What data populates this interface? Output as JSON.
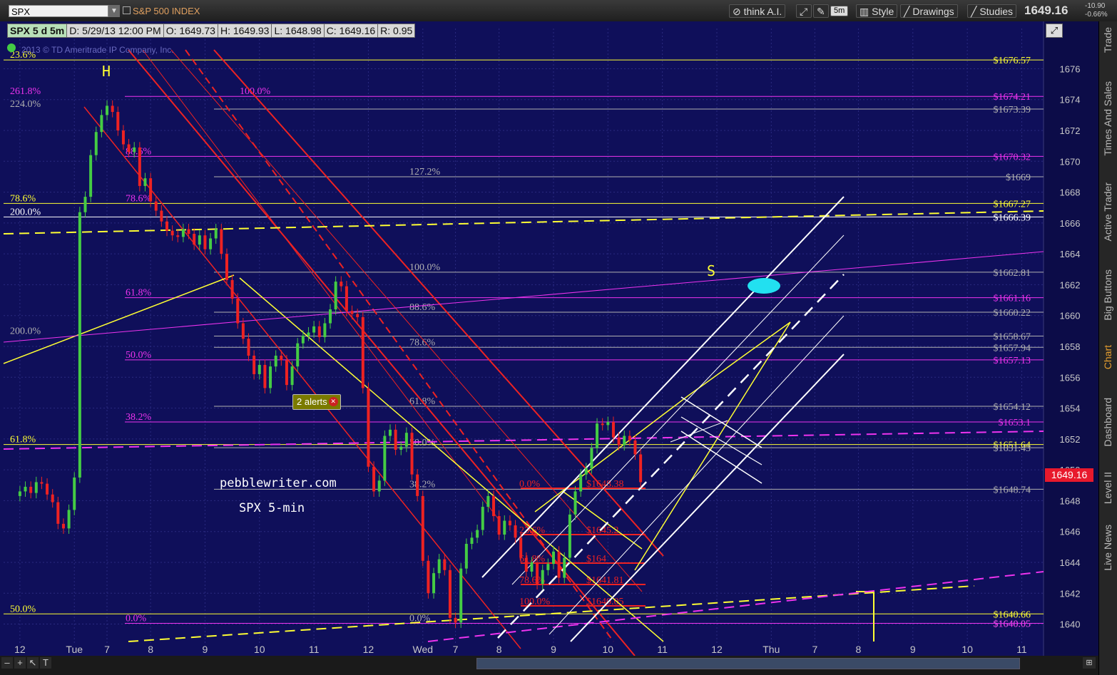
{
  "toolbar": {
    "symbol": "SPX",
    "index_name": "S&P 500 INDEX",
    "buttons": [
      "think A.I.",
      "5m",
      "Style",
      "Drawings",
      "Studies"
    ],
    "last_price": "1649.16",
    "change_abs": "-10.90",
    "change_pct": "-0.66%"
  },
  "quote_bar": {
    "symbol": "SPX 5 d 5m",
    "date": "D: 5/29/13 12:00 PM",
    "open": "O: 1649.73",
    "high": "H: 1649.93",
    "low": "L: 1648.98",
    "close": "C: 1649.16",
    "range": "R: 0.95"
  },
  "copyright": "2013 © TD Ameritrade IP Company, Inc.",
  "alerts_label": "2 alerts",
  "price_badge": "1649.16",
  "annotations": {
    "site": "pebblewriter.com",
    "subtitle": "SPX 5-min",
    "h_label": "H",
    "s_label": "S"
  },
  "sidebar_tabs": [
    "Trade",
    "Times And Sales",
    "Active Trader",
    "Big Buttons",
    "Chart",
    "Dashboard",
    "Level II",
    "Live News"
  ],
  "colors": {
    "background": "#10105a",
    "grid": "#2a2a80",
    "up_candle": "#44cc44",
    "down_candle": "#ee2222",
    "yellow": "#ffff33",
    "magenta": "#ee33ee",
    "gray_fib": "#b0b0b0",
    "red_channel": "#ee2222",
    "white_channel": "#ffffff",
    "cyan_target": "#22e0f0"
  },
  "chart_data": {
    "type": "line",
    "title": "SPX 5 d 5m",
    "ylim": [
      1638.5,
      1677.5
    ],
    "y_ticks": [
      1640,
      1642,
      1644,
      1646,
      1648,
      1650,
      1652,
      1654,
      1656,
      1658,
      1660,
      1662,
      1664,
      1666,
      1668,
      1670,
      1672,
      1674,
      1676
    ],
    "x_tick_labels": [
      "12",
      "Tue",
      "7",
      "8",
      "9",
      "10",
      "11",
      "12",
      "Wed",
      "7",
      "8",
      "9",
      "10",
      "11",
      "12",
      "Thu",
      "7",
      "8",
      "9",
      "10",
      "11"
    ],
    "x_tick_index": [
      0,
      10,
      16,
      24,
      34,
      44,
      54,
      64,
      74,
      80,
      88,
      98,
      108,
      118,
      128,
      138,
      146,
      154,
      164,
      174,
      184
    ],
    "x_range": [
      -3,
      188
    ],
    "close_series": [
      1648.6,
      1648.9,
      1648.5,
      1649.2,
      1649.1,
      1648.4,
      1647.9,
      1646.5,
      1646.2,
      1647.4,
      1649.5,
      1666.7,
      1667.7,
      1670.4,
      1671.9,
      1673.0,
      1673.6,
      1673.2,
      1672.0,
      1671.1,
      1670.6,
      1670.9,
      1668.4,
      1668.9,
      1667.4,
      1666.8,
      1666.1,
      1665.5,
      1665.2,
      1665.1,
      1665.6,
      1665.3,
      1664.6,
      1665.2,
      1664.3,
      1665.0,
      1665.6,
      1664.0,
      1662.3,
      1661.1,
      1659.5,
      1658.5,
      1657.4,
      1656.2,
      1656.8,
      1655.3,
      1656.7,
      1657.4,
      1657.1,
      1655.5,
      1656.7,
      1658.2,
      1658.7,
      1658.9,
      1659.3,
      1658.6,
      1659.5,
      1660.4,
      1662.2,
      1661.9,
      1660.3,
      1660.1,
      1659.9,
      1655.3,
      1650.2,
      1648.6,
      1649.3,
      1652.2,
      1652.6,
      1651.3,
      1651.5,
      1652.4,
      1649.7,
      1648.3,
      1644.1,
      1642.0,
      1643.3,
      1644.2,
      1643.5,
      1640.4,
      1640.1,
      1643.6,
      1645.2,
      1645.6,
      1646.1,
      1647.6,
      1648.3,
      1647.0,
      1645.8,
      1646.7,
      1646.4,
      1645.6,
      1644.3,
      1643.4,
      1644.0,
      1642.6,
      1643.5,
      1643.9,
      1644.7,
      1643.0,
      1644.3,
      1647.1,
      1648.6,
      1649.7,
      1650.1,
      1651.4,
      1653.0,
      1652.9,
      1653.1,
      1652.1,
      1651.6,
      1652.2,
      1651.9,
      1651.0,
      1649.2
    ],
    "levels": [
      {
        "label": "$1676.57",
        "value": 1676.57,
        "color": "#ffff33"
      },
      {
        "label": "$1674.21",
        "value": 1674.21,
        "color": "#ee33ee"
      },
      {
        "label": "$1673.39",
        "value": 1673.39,
        "color": "#b0b0b0"
      },
      {
        "label": "$1670.32",
        "value": 1670.32,
        "color": "#ee33ee"
      },
      {
        "label": "$1669",
        "value": 1669.0,
        "color": "#b0b0b0"
      },
      {
        "label": "$1667.27",
        "value": 1667.27,
        "color": "#ffff33"
      },
      {
        "label": "$1666.39",
        "value": 1666.39,
        "color": "#ffffff"
      },
      {
        "label": "$1662.81",
        "value": 1662.81,
        "color": "#b0b0b0"
      },
      {
        "label": "$1661.16",
        "value": 1661.16,
        "color": "#ee33ee"
      },
      {
        "label": "$1660.22",
        "value": 1660.22,
        "color": "#b0b0b0"
      },
      {
        "label": "$1658.67",
        "value": 1658.67,
        "color": "#b0b0b0"
      },
      {
        "label": "$1657.94",
        "value": 1657.94,
        "color": "#b0b0b0"
      },
      {
        "label": "$1657.13",
        "value": 1657.13,
        "color": "#ee33ee"
      },
      {
        "label": "$1654.12",
        "value": 1654.12,
        "color": "#b0b0b0"
      },
      {
        "label": "$1653.1",
        "value": 1653.1,
        "color": "#ee33ee"
      },
      {
        "label": "$1651.64",
        "value": 1651.64,
        "color": "#ffff33"
      },
      {
        "label": "$1651.43",
        "value": 1651.43,
        "color": "#b0b0b0"
      },
      {
        "label": "$1648.74",
        "value": 1648.74,
        "color": "#b0b0b0"
      },
      {
        "label": "$1640.66",
        "value": 1640.66,
        "color": "#ffff33"
      },
      {
        "label": "$1640.05",
        "value": 1640.05,
        "color": "#b0b0b0"
      },
      {
        "label": "$1640.05",
        "value": 1640.05,
        "color": "#ee33ee"
      }
    ],
    "fib_labels": [
      {
        "text": "23.6%",
        "value": 1676.57,
        "color": "#ffff33"
      },
      {
        "text": "261.8%",
        "value": 1674.21,
        "color": "#ee33ee"
      },
      {
        "text": "224.0%",
        "value": 1673.39,
        "color": "#b0b0b0"
      },
      {
        "text": "100.0%",
        "value": 1674.21,
        "color": "#ee33ee"
      },
      {
        "text": "88.6%",
        "value": 1670.32,
        "color": "#ee33ee"
      },
      {
        "text": "127.2%",
        "value": 1669.0,
        "color": "#b0b0b0"
      },
      {
        "text": "78.6%",
        "value": 1667.27,
        "color": "#ffff33"
      },
      {
        "text": "78.6%",
        "value": 1667.27,
        "color": "#ee33ee"
      },
      {
        "text": "200.0%",
        "value": 1666.39,
        "color": "#ffffff"
      },
      {
        "text": "100.0%",
        "value": 1662.81,
        "color": "#b0b0b0"
      },
      {
        "text": "61.8%",
        "value": 1661.16,
        "color": "#ee33ee"
      },
      {
        "text": "88.6%",
        "value": 1660.22,
        "color": "#b0b0b0"
      },
      {
        "text": "200.0%",
        "value": 1658.67,
        "color": "#b0b0b0"
      },
      {
        "text": "78.6%",
        "value": 1657.94,
        "color": "#b0b0b0"
      },
      {
        "text": "50.0%",
        "value": 1657.13,
        "color": "#ee33ee"
      },
      {
        "text": "61.8%",
        "value": 1654.12,
        "color": "#b0b0b0"
      },
      {
        "text": "38.2%",
        "value": 1653.1,
        "color": "#ee33ee"
      },
      {
        "text": "61.8%",
        "value": 1651.64,
        "color": "#ffff33"
      },
      {
        "text": "50.0%",
        "value": 1651.43,
        "color": "#b0b0b0"
      },
      {
        "text": "38.2%",
        "value": 1648.74,
        "color": "#b0b0b0"
      },
      {
        "text": "50.0%",
        "value": 1640.66,
        "color": "#ffff33"
      },
      {
        "text": "0.0%",
        "value": 1640.05,
        "color": "#ee33ee"
      },
      {
        "text": "0.0%",
        "value": 1640.05,
        "color": "#b0b0b0"
      }
    ],
    "red_fib_labels": [
      {
        "text": "0.0%",
        "value": 1648.4
      },
      {
        "text": "$1648.38",
        "value": 1648.4
      },
      {
        "text": "23.6%",
        "value": 1646.4
      },
      {
        "text": "$1645.2",
        "value": 1646.4
      },
      {
        "text": "61.8%",
        "value": 1644.5
      },
      {
        "text": "$164",
        "value": 1644.5
      },
      {
        "text": "78.6%",
        "value": 1643.3
      },
      {
        "text": "$1641.81",
        "value": 1643.3
      },
      {
        "text": "100.0%",
        "value": 1641.5
      },
      {
        "text": "$1640.05",
        "value": 1641.5
      }
    ]
  }
}
